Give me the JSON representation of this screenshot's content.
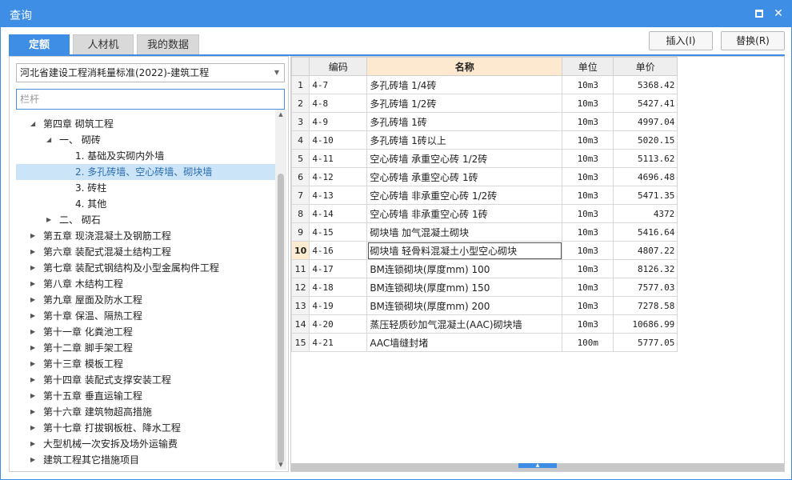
{
  "window": {
    "title": "查询",
    "restore_glyph": "",
    "close_glyph": "✕"
  },
  "tabs": [
    {
      "label": "定额",
      "active": true
    },
    {
      "label": "人材机",
      "active": false
    },
    {
      "label": "我的数据",
      "active": false
    }
  ],
  "toolbar": {
    "insert_label": "插入(I)",
    "replace_label": "替换(R)"
  },
  "quota_library": {
    "selected": "河北省建设工程消耗量标准(2022)-建筑工程"
  },
  "search": {
    "value": "",
    "placeholder": "栏杆"
  },
  "tree": [
    {
      "label": "第四章 砌筑工程",
      "expanded": true
    },
    {
      "label": "一、 砌砖",
      "expanded": true
    },
    {
      "label": "1. 基础及实砌内外墙"
    },
    {
      "label": "2. 多孔砖墙、空心砖墙、砌块墙",
      "selected": true
    },
    {
      "label": "3. 砖柱"
    },
    {
      "label": "4. 其他"
    },
    {
      "label": "二、 砌石",
      "expanded": false
    },
    {
      "label": "第五章 现浇混凝土及钢筋工程",
      "expanded": false
    },
    {
      "label": "第六章 装配式混凝土结构工程",
      "expanded": false
    },
    {
      "label": "第七章 装配式钢结构及小型金属构件工程",
      "expanded": false
    },
    {
      "label": "第八章 木结构工程",
      "expanded": false
    },
    {
      "label": "第九章 屋面及防水工程",
      "expanded": false
    },
    {
      "label": "第十章 保温、隔热工程",
      "expanded": false
    },
    {
      "label": "第十一章 化粪池工程",
      "expanded": false
    },
    {
      "label": "第十二章 脚手架工程",
      "expanded": false
    },
    {
      "label": "第十三章 模板工程",
      "expanded": false
    },
    {
      "label": "第十四章 装配式支撑安装工程",
      "expanded": false
    },
    {
      "label": "第十五章 垂直运输工程",
      "expanded": false
    },
    {
      "label": "第十六章 建筑物超高措施",
      "expanded": false
    },
    {
      "label": "第十七章 打拔钢板桩、降水工程",
      "expanded": false
    },
    {
      "label": "大型机械一次安拆及场外运输费",
      "expanded": false
    },
    {
      "label": "建筑工程其它措施项目",
      "expanded": false
    }
  ],
  "grid": {
    "headers": {
      "code": "编码",
      "name": "名称",
      "unit": "单位",
      "price": "单价"
    },
    "current_row": 10,
    "rows": [
      {
        "no": "1",
        "code": "4-7",
        "name": "多孔砖墙 1/4砖",
        "unit": "10m3",
        "price": "5368.42"
      },
      {
        "no": "2",
        "code": "4-8",
        "name": "多孔砖墙 1/2砖",
        "unit": "10m3",
        "price": "5427.41"
      },
      {
        "no": "3",
        "code": "4-9",
        "name": "多孔砖墙 1砖",
        "unit": "10m3",
        "price": "4997.04"
      },
      {
        "no": "4",
        "code": "4-10",
        "name": "多孔砖墙 1砖以上",
        "unit": "10m3",
        "price": "5020.15"
      },
      {
        "no": "5",
        "code": "4-11",
        "name": "空心砖墙 承重空心砖 1/2砖",
        "unit": "10m3",
        "price": "5113.62"
      },
      {
        "no": "6",
        "code": "4-12",
        "name": "空心砖墙 承重空心砖 1砖",
        "unit": "10m3",
        "price": "4696.48"
      },
      {
        "no": "7",
        "code": "4-13",
        "name": "空心砖墙 非承重空心砖 1/2砖",
        "unit": "10m3",
        "price": "5471.35"
      },
      {
        "no": "8",
        "code": "4-14",
        "name": "空心砖墙 非承重空心砖 1砖",
        "unit": "10m3",
        "price": "4372"
      },
      {
        "no": "9",
        "code": "4-15",
        "name": "砌块墙 加气混凝土砌块",
        "unit": "10m3",
        "price": "5416.64"
      },
      {
        "no": "10",
        "code": "4-16",
        "name": "砌块墙 轻骨料混凝土小型空心砌块",
        "unit": "10m3",
        "price": "4807.22"
      },
      {
        "no": "11",
        "code": "4-17",
        "name": "BM连锁砌块(厚度mm) 100",
        "unit": "10m3",
        "price": "8126.32"
      },
      {
        "no": "12",
        "code": "4-18",
        "name": "BM连锁砌块(厚度mm) 150",
        "unit": "10m3",
        "price": "7577.03"
      },
      {
        "no": "13",
        "code": "4-19",
        "name": "BM连锁砌块(厚度mm) 200",
        "unit": "10m3",
        "price": "7278.58"
      },
      {
        "no": "14",
        "code": "4-20",
        "name": "蒸压轻质砂加气混凝土(AAC)砌块墙",
        "unit": "10m3",
        "price": "10686.99"
      },
      {
        "no": "15",
        "code": "4-21",
        "name": "AAC墙缝封堵",
        "unit": "100m",
        "price": "5777.05"
      }
    ]
  },
  "colors": {
    "accent": "#3d8ee4",
    "selected_row": "#cce4f7",
    "header_highlight": "#fce9cf"
  },
  "icons": {
    "restore": "restore-icon",
    "close": "close-icon",
    "expanded": "triangle-down-icon",
    "collapsed": "triangle-right-icon"
  }
}
